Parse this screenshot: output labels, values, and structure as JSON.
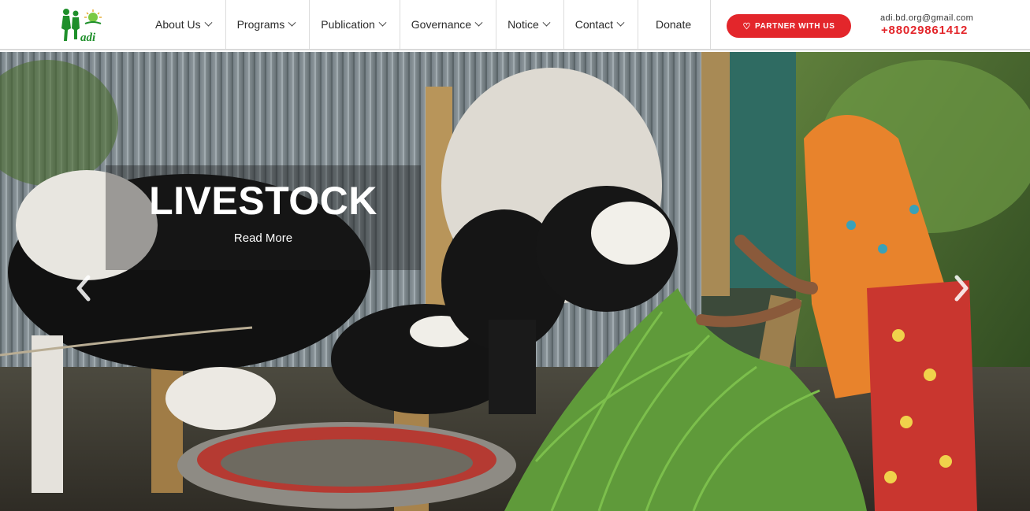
{
  "brand": {
    "logo_text": "adi"
  },
  "nav": {
    "items": [
      {
        "label": "About Us",
        "has_dropdown": true
      },
      {
        "label": "Programs",
        "has_dropdown": true
      },
      {
        "label": "Publication",
        "has_dropdown": true
      },
      {
        "label": "Governance",
        "has_dropdown": true
      },
      {
        "label": "Notice",
        "has_dropdown": true
      },
      {
        "label": "Contact",
        "has_dropdown": true
      },
      {
        "label": "Donate",
        "has_dropdown": false
      }
    ]
  },
  "cta": {
    "label": "PARTNER WITH US",
    "icon": "heart-icon"
  },
  "contact": {
    "email": "adi.bd.org@gmail.com",
    "phone": "+88029861412"
  },
  "hero": {
    "title": "LIVESTOCK",
    "link_label": "Read More",
    "prev_icon": "chevron-left-icon",
    "next_icon": "chevron-right-icon"
  },
  "colors": {
    "accent": "#e3262b",
    "brand_green": "#1e8f2a",
    "nav_text": "#2b2b2b"
  }
}
